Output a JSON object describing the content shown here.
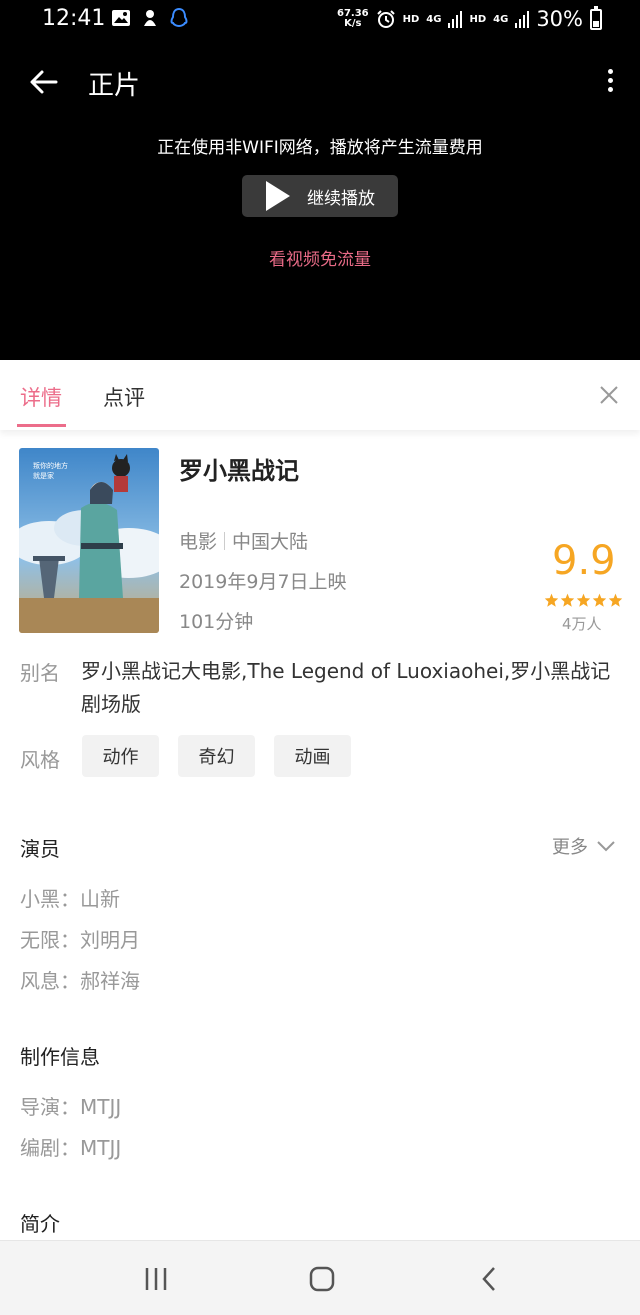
{
  "status_bar": {
    "time": "12:41",
    "net_speed_value": "67.36",
    "net_speed_unit": "K/s",
    "hd1": "HD",
    "net1": "4G",
    "hd2": "HD",
    "net2": "4G",
    "battery": "30%"
  },
  "player": {
    "title": "正片",
    "network_warning": "正在使用非WIFI网络，播放将产生流量费用",
    "continue_label": "继续播放",
    "free_flow_link": "看视频免流量"
  },
  "tabs": [
    {
      "label": "详情"
    },
    {
      "label": "点评"
    }
  ],
  "movie": {
    "title": "罗小黑战记",
    "type": "电影",
    "region": "中国大陆",
    "release": "2019年9月7日上映",
    "duration": "101分钟",
    "rating": "9.9",
    "stars": 5,
    "rating_count": "4万人",
    "poster_text": [
      "叛你的地方",
      "就是家"
    ],
    "alias_label": "别名",
    "alias": "罗小黑战记大电影,The Legend of Luoxiaohei,罗小黑战记剧场版",
    "genre_label": "风格",
    "genres": [
      "动作",
      "奇幻",
      "动画"
    ]
  },
  "cast": {
    "title": "演员",
    "more": "更多",
    "items": [
      "小黑：山新",
      "无限：刘明月",
      "风息：郝祥海"
    ]
  },
  "production": {
    "title": "制作信息",
    "items": [
      "导演：MTJJ",
      "编剧：MTJJ"
    ]
  },
  "intro": {
    "title": "简介"
  },
  "colors": {
    "accent": "#ec6d8a",
    "rating": "#f6a623",
    "free_flow": "#e96b87"
  }
}
